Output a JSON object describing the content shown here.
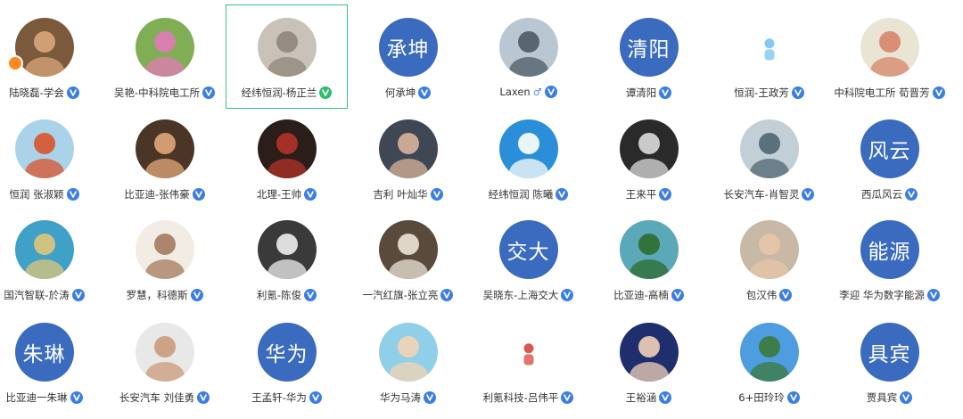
{
  "members": [
    {
      "name": "陆晓磊-学会",
      "avatar": {
        "type": "photo",
        "bg": "#7b5a3c",
        "fg": "#d9a77a"
      },
      "badge": "blue",
      "status_dot": true
    },
    {
      "name": "吴艳-中科院电工所",
      "avatar": {
        "type": "photo",
        "bg": "#7fae55",
        "fg": "#e17bb7"
      },
      "badge": "blue"
    },
    {
      "name": "经纬恒润-杨正兰",
      "avatar": {
        "type": "photo",
        "bg": "#c9c2b8",
        "fg": "#8f857a"
      },
      "badge": "green",
      "selected": true
    },
    {
      "name": "何承坤",
      "avatar": {
        "type": "text",
        "text": "承坤"
      },
      "badge": "blue"
    },
    {
      "name": "Laxen",
      "gender": "♂",
      "avatar": {
        "type": "photo",
        "bg": "#b9c7d2",
        "fg": "#4d5b66"
      },
      "badge": "blue"
    },
    {
      "name": "谭清阳",
      "avatar": {
        "type": "text",
        "text": "清阳"
      },
      "badge": "blue"
    },
    {
      "name": "恒润-王政芳",
      "avatar": {
        "type": "photo",
        "bg": "#ffffff",
        "fg": "#6ec0ef",
        "small": true
      },
      "badge": "blue"
    },
    {
      "name": "中科院电工所 荀晋芳",
      "avatar": {
        "type": "photo",
        "bg": "#eae4d4",
        "fg": "#d6856a"
      },
      "badge": "blue"
    },
    {
      "name": "恒润 张淑颖",
      "avatar": {
        "type": "photo",
        "bg": "#aad3ea",
        "fg": "#d9532b"
      },
      "badge": "blue"
    },
    {
      "name": "比亚迪-张伟豪",
      "avatar": {
        "type": "photo",
        "bg": "#4b3527",
        "fg": "#e0a979"
      },
      "badge": "blue"
    },
    {
      "name": "北理-王帅",
      "avatar": {
        "type": "photo",
        "bg": "#2b1d19",
        "fg": "#b2332a"
      },
      "badge": "blue"
    },
    {
      "name": "吉利 叶灿华",
      "avatar": {
        "type": "photo",
        "bg": "#3f4654",
        "fg": "#d8b49a"
      },
      "badge": "blue"
    },
    {
      "name": "经纬恒润 陈曦",
      "avatar": {
        "type": "photo",
        "bg": "#2b8ed8",
        "fg": "#ffffff"
      },
      "badge": "blue"
    },
    {
      "name": "王来平",
      "avatar": {
        "type": "photo",
        "bg": "#2a2a2a",
        "fg": "#dcdcdc"
      },
      "badge": "blue"
    },
    {
      "name": "长安汽车-肖智灵",
      "avatar": {
        "type": "photo",
        "bg": "#c2cfd7",
        "fg": "#4f6572"
      },
      "badge": "blue"
    },
    {
      "name": "西瓜风云",
      "avatar": {
        "type": "text",
        "text": "风云"
      },
      "badge": "blue"
    },
    {
      "name": "国汽智联-於涛",
      "avatar": {
        "type": "photo",
        "bg": "#3fa0c8",
        "fg": "#e0c67a"
      },
      "badge": "blue"
    },
    {
      "name": "罗慧，科德斯",
      "avatar": {
        "type": "photo",
        "bg": "#f3ece4",
        "fg": "#a37b5e"
      },
      "badge": "blue"
    },
    {
      "name": "利氪-陈俊",
      "avatar": {
        "type": "photo",
        "bg": "#3a3a3a",
        "fg": "#efefef"
      },
      "badge": "blue"
    },
    {
      "name": "一汽红旗-张立亮",
      "avatar": {
        "type": "photo",
        "bg": "#5a4a3c",
        "fg": "#ede4d8"
      },
      "badge": "blue"
    },
    {
      "name": "吴晓东-上海交大",
      "avatar": {
        "type": "text",
        "text": "交大"
      },
      "badge": "blue"
    },
    {
      "name": "比亚迪-高楠",
      "avatar": {
        "type": "photo",
        "bg": "#5aa8b8",
        "fg": "#2e6b2d"
      },
      "badge": "blue"
    },
    {
      "name": "包汉伟",
      "avatar": {
        "type": "photo",
        "bg": "#c8b8a6",
        "fg": "#e8c6a8"
      },
      "badge": "blue"
    },
    {
      "name": "李迎  华为数字能源",
      "avatar": {
        "type": "text",
        "text": "能源"
      },
      "badge": "blue"
    },
    {
      "name": "比亚迪一朱琳",
      "avatar": {
        "type": "text",
        "text": "朱琳"
      },
      "badge": "blue"
    },
    {
      "name": "长安汽车 刘佳勇",
      "avatar": {
        "type": "photo",
        "bg": "#e8e8e8",
        "fg": "#c99b7a"
      },
      "badge": "blue"
    },
    {
      "name": "王孟轩-华为",
      "avatar": {
        "type": "text",
        "text": "华为"
      },
      "badge": "blue"
    },
    {
      "name": "华为马涛",
      "avatar": {
        "type": "photo",
        "bg": "#8fd0e8",
        "fg": "#f4d4b4"
      },
      "badge": "blue"
    },
    {
      "name": "利氪科技-吕伟平",
      "avatar": {
        "type": "photo",
        "bg": "#ffffff",
        "fg": "#d23a2e",
        "small": true
      },
      "badge": "blue"
    },
    {
      "name": "王裕涵",
      "avatar": {
        "type": "photo",
        "bg": "#1f2f6e",
        "fg": "#f1d2b8"
      },
      "badge": "blue"
    },
    {
      "name": "6+田玲玲",
      "avatar": {
        "type": "photo",
        "bg": "#4d9de0",
        "fg": "#3c7a3a"
      },
      "badge": "blue"
    },
    {
      "name": "贾具宾",
      "avatar": {
        "type": "text",
        "text": "具宾"
      },
      "badge": "blue"
    }
  ]
}
